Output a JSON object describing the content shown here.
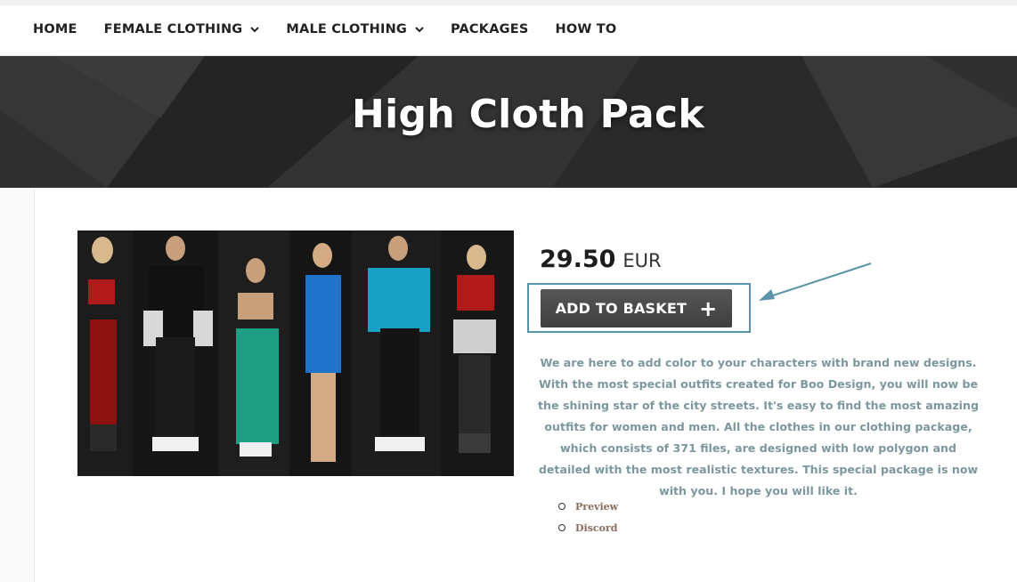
{
  "nav": {
    "items": [
      {
        "label": "HOME",
        "dropdown": false
      },
      {
        "label": "FEMALE CLOTHING",
        "dropdown": true
      },
      {
        "label": "MALE CLOTHING",
        "dropdown": true
      },
      {
        "label": "PACKAGES",
        "dropdown": false
      },
      {
        "label": "HOW TO",
        "dropdown": false
      }
    ]
  },
  "hero": {
    "title": "High Cloth Pack"
  },
  "product": {
    "price_amount": "29.50",
    "price_currency": "EUR",
    "add_to_basket_label": "ADD TO BASKET",
    "description": "We are here to add color to your characters with brand new designs. With the most special outfits created for Boo Design, you will now be the shining star of the city streets. It's easy to find the most amazing outfits for women and men. All the clothes in our clothing package, which consists of 371 files, are designed with low polygon and detailed with the most realistic textures. This special package is now with you. I hope you will like it.",
    "links": [
      {
        "label": "Preview"
      },
      {
        "label": "Discord"
      }
    ]
  },
  "colors": {
    "accent_annotation": "#5b93a8",
    "description_text": "#7c979d",
    "link_text": "#8a6d5c",
    "button_bg": "#4a4a4a"
  },
  "icons": {
    "dropdown": "chevron-down-icon",
    "add": "plus-icon",
    "bullet": "circle-bullet-icon"
  }
}
